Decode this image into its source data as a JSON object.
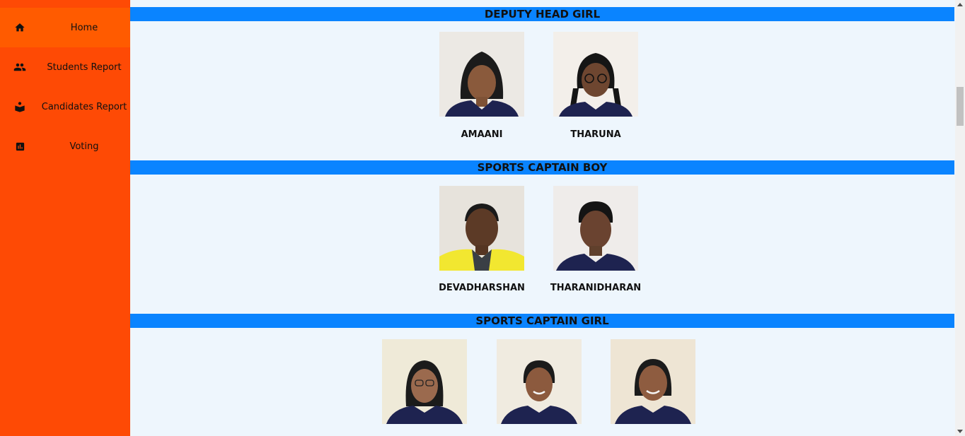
{
  "sidebar": {
    "items": [
      {
        "label": "Home",
        "icon": "home-icon",
        "active": true
      },
      {
        "label": "Students Report",
        "icon": "people-icon"
      },
      {
        "label": "Candidates Report",
        "icon": "book-icon"
      },
      {
        "label": "Voting",
        "icon": "bar-chart-icon"
      }
    ]
  },
  "sections": [
    {
      "title": "DEPUTY HEAD GIRL",
      "candidates": [
        "AMAANI",
        "THARUNA"
      ]
    },
    {
      "title": "SPORTS CAPTAIN BOY",
      "candidates": [
        "DEVADHARSHAN",
        "THARANIDHARAN"
      ]
    },
    {
      "title": "SPORTS CAPTAIN GIRL",
      "candidates": [
        "",
        "",
        ""
      ]
    }
  ],
  "colors": {
    "sidebar": "#fe4a05",
    "sidebar_active": "#ff5b00",
    "section_bar": "#0a84ff",
    "background": "#eef6fd",
    "uniform": "#1e2350"
  }
}
